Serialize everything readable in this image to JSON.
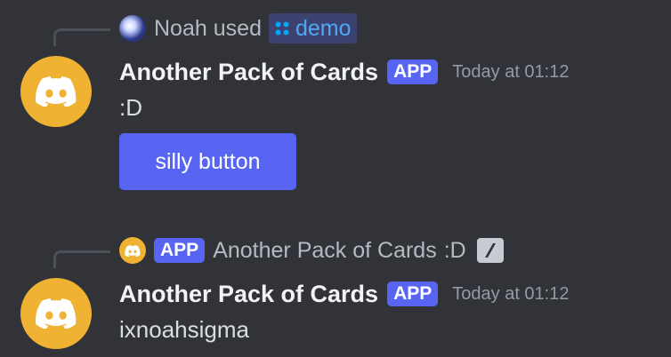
{
  "colors": {
    "background": "#313338",
    "accent": "#5865f2",
    "bot_avatar": "#f0b232",
    "muted_text": "#b5bac1",
    "timestamp": "#949ba4"
  },
  "messages": [
    {
      "reply": {
        "user": "Noah",
        "action": "used",
        "command": "demo",
        "command_icon": "slash-command-icon"
      },
      "author": "Another Pack of Cards",
      "tag": "APP",
      "timestamp": "Today at 01:12",
      "content": ":D",
      "button_label": "silly button"
    },
    {
      "reply": {
        "tag": "APP",
        "author": "Another Pack of Cards",
        "snippet": ":D",
        "icon": "interaction-icon"
      },
      "author": "Another Pack of Cards",
      "tag": "APP",
      "timestamp": "Today at 01:12",
      "content": "ixnoahsigma"
    }
  ]
}
